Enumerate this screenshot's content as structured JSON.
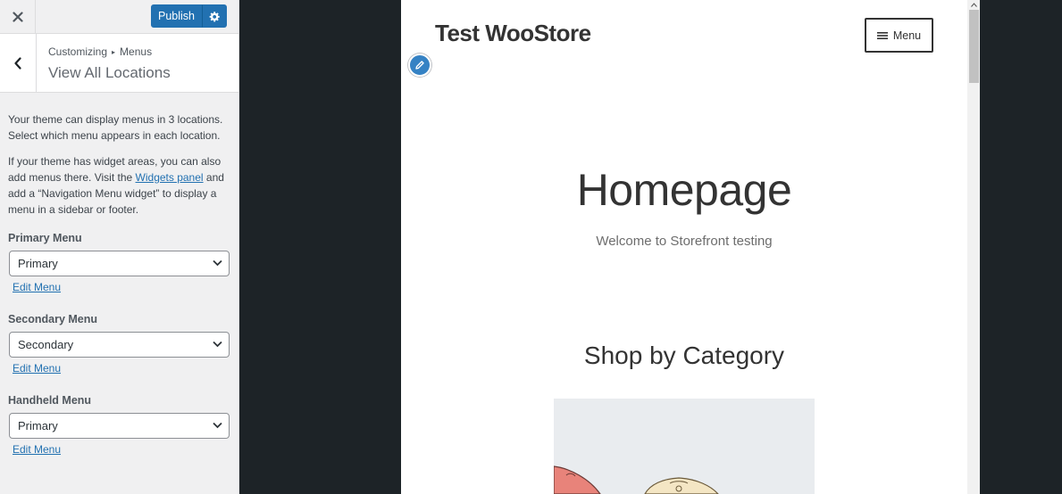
{
  "topbar": {
    "close_icon": "close-icon",
    "publish_label": "Publish",
    "settings_icon": "gear-icon"
  },
  "section": {
    "back_icon": "chevron-left-icon",
    "breadcrumb_parent": "Customizing",
    "breadcrumb_sep": "▸",
    "breadcrumb_current": "Menus",
    "title": "View All Locations"
  },
  "description": {
    "p1": "Your theme can display menus in 3 locations. Select which menu appears in each location.",
    "p2_before": "If your theme has widget areas, you can also add menus there. Visit the ",
    "p2_link": "Widgets panel",
    "p2_after": " and add a “Navigation Menu widget” to display a menu in a sidebar or footer."
  },
  "locations": [
    {
      "label": "Primary Menu",
      "selected": "Primary",
      "edit_label": "Edit Menu"
    },
    {
      "label": "Secondary Menu",
      "selected": "Secondary",
      "edit_label": "Edit Menu"
    },
    {
      "label": "Handheld Menu",
      "selected": "Primary",
      "edit_label": "Edit Menu"
    }
  ],
  "preview": {
    "site_title": "Test WooStore",
    "edit_shortcut_icon": "pencil-icon",
    "menu_icon": "hamburger-icon",
    "menu_label": "Menu",
    "hero_title": "Homepage",
    "hero_subtitle": "Welcome to Storefront testing",
    "section_heading": "Shop by Category"
  },
  "colors": {
    "accent": "#2271b1",
    "sidebar_bg": "#f0f0f1",
    "preview_backdrop": "#1d2327",
    "shortcut": "#3582c4"
  }
}
